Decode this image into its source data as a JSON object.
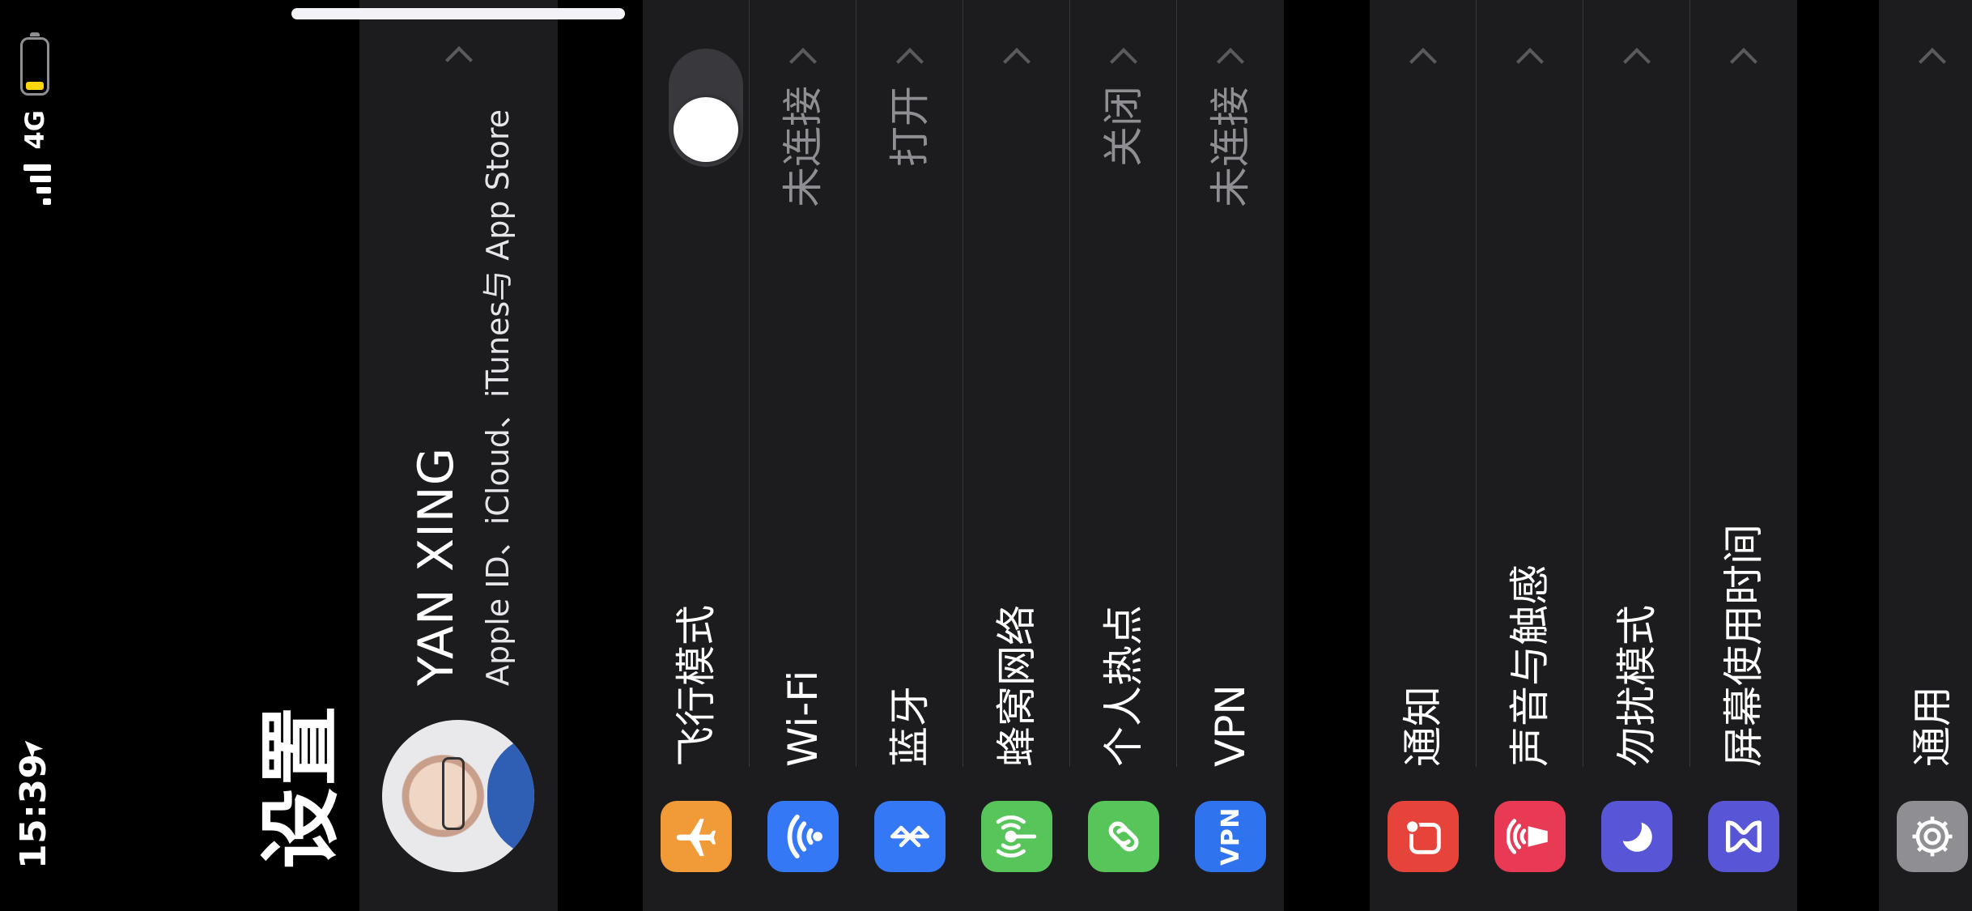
{
  "status_bar": {
    "time": "15:39",
    "network": "4G"
  },
  "page": {
    "title": "设置"
  },
  "profile": {
    "name": "YAN XING",
    "subtitle": "Apple ID、iCloud、iTunes与 App Store"
  },
  "group1": [
    {
      "label": "飞行模式",
      "icon": "airplane-icon",
      "color": "#f19a38",
      "toggle": "off"
    },
    {
      "label": "Wi-Fi",
      "icon": "wifi-icon",
      "color": "#3478f6",
      "value": "未连接"
    },
    {
      "label": "蓝牙",
      "icon": "bluetooth-icon",
      "color": "#3478f6",
      "value": "打开"
    },
    {
      "label": "蜂窝网络",
      "icon": "cellular-icon",
      "color": "#58c55b",
      "value": ""
    },
    {
      "label": "个人热点",
      "icon": "hotspot-icon",
      "color": "#58c55b",
      "value": "关闭"
    },
    {
      "label": "VPN",
      "icon": "vpn-icon",
      "icon_text": "VPN",
      "color": "#2f73ee",
      "value": "未连接"
    }
  ],
  "group2": [
    {
      "label": "通知",
      "icon": "notifications-icon",
      "color": "#e6443a"
    },
    {
      "label": "声音与触感",
      "icon": "sound-icon",
      "color": "#e93a55"
    },
    {
      "label": "勿扰模式",
      "icon": "moon-icon",
      "color": "#5856d6"
    },
    {
      "label": "屏幕使用时间",
      "icon": "screen-time-icon",
      "color": "#5856d6"
    }
  ],
  "group3": [
    {
      "label": "通用",
      "icon": "gear-icon",
      "color": "#8e8e93"
    }
  ]
}
